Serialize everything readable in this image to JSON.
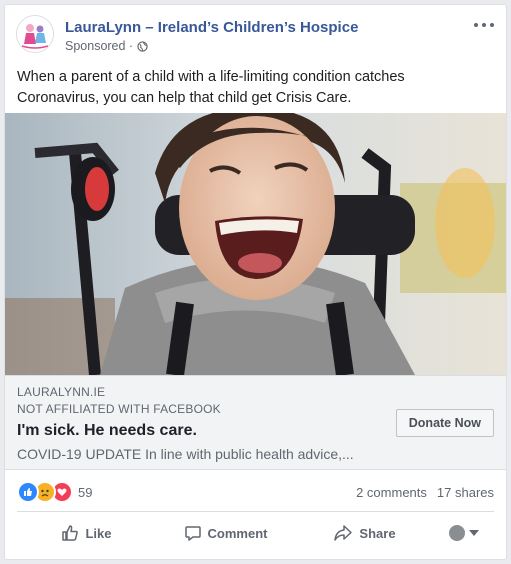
{
  "post": {
    "page_name": "LauraLynn – Ireland’s Children’s Hospice",
    "sponsored_label": "Sponsored ·",
    "text": "When a parent of a child with a life-limiting condition catches Coronavirus, you can help that child get Crisis Care."
  },
  "link_preview": {
    "domain": "LAURALYNN.IE",
    "disclaimer": "NOT AFFILIATED WITH FACEBOOK",
    "headline": "I'm sick. He needs care.",
    "description": "COVID-19 UPDATE In line with public health advice,...",
    "cta_label": "Donate Now"
  },
  "engagement": {
    "reaction_count": "59",
    "comments": "2 comments",
    "shares": "17 shares"
  },
  "actions": {
    "like": "Like",
    "comment": "Comment",
    "share": "Share"
  },
  "icons": {
    "options": "more-options-icon",
    "privacy": "globe-icon",
    "like": "thumbs-up-icon",
    "comment": "comment-bubble-icon",
    "share": "share-arrow-icon"
  },
  "colors": {
    "link_blue": "#385898",
    "like_blue": "#2d88ff",
    "sad_yellow": "#f7b125",
    "love_red": "#f33e58"
  }
}
